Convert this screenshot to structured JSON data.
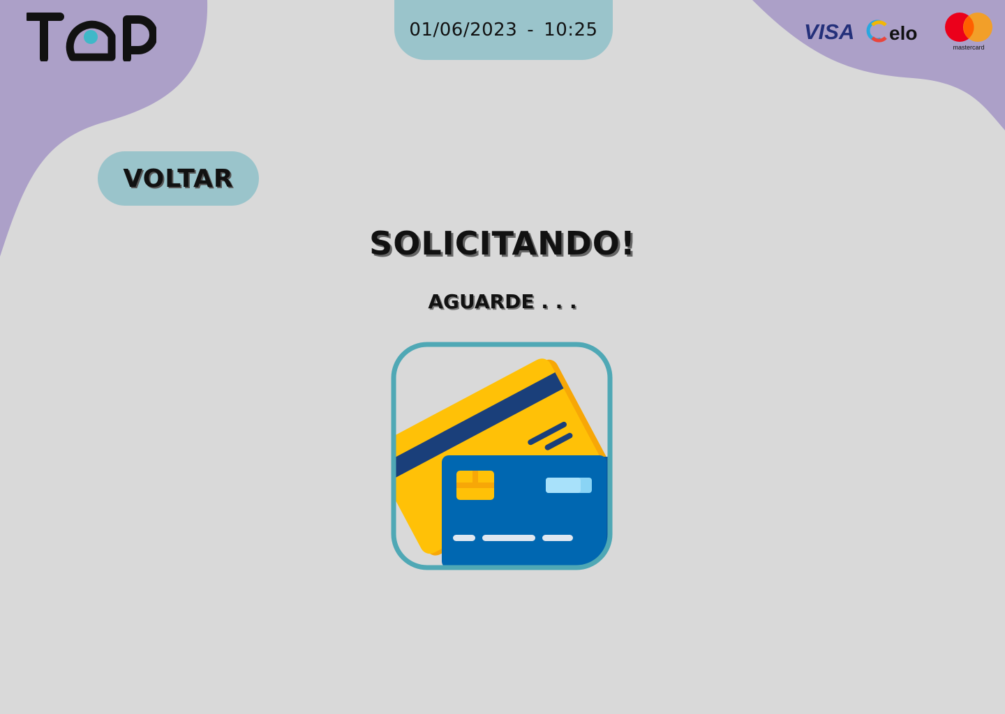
{
  "header": {
    "logo_text": "TOP",
    "date": "01/06/2023",
    "separator": "-",
    "time": "10:25"
  },
  "brands": [
    {
      "name": "VISA",
      "icon": "visa-logo"
    },
    {
      "name": "elo",
      "icon": "elo-logo"
    },
    {
      "name": "mastercard",
      "icon": "mastercard-logo"
    }
  ],
  "back_button": {
    "label": "VOLTAR"
  },
  "status": {
    "title": "SOLICITANDO!",
    "subtitle": "AGUARDE . . ."
  },
  "illustration": {
    "icon": "credit-cards-icon"
  },
  "colors": {
    "background": "#d9d9d9",
    "blob": "#aca0c8",
    "accent": "#9ac4cb",
    "frame": "#4fa8b5",
    "card_yellow": "#ffc107",
    "card_blue": "#0067b1"
  }
}
